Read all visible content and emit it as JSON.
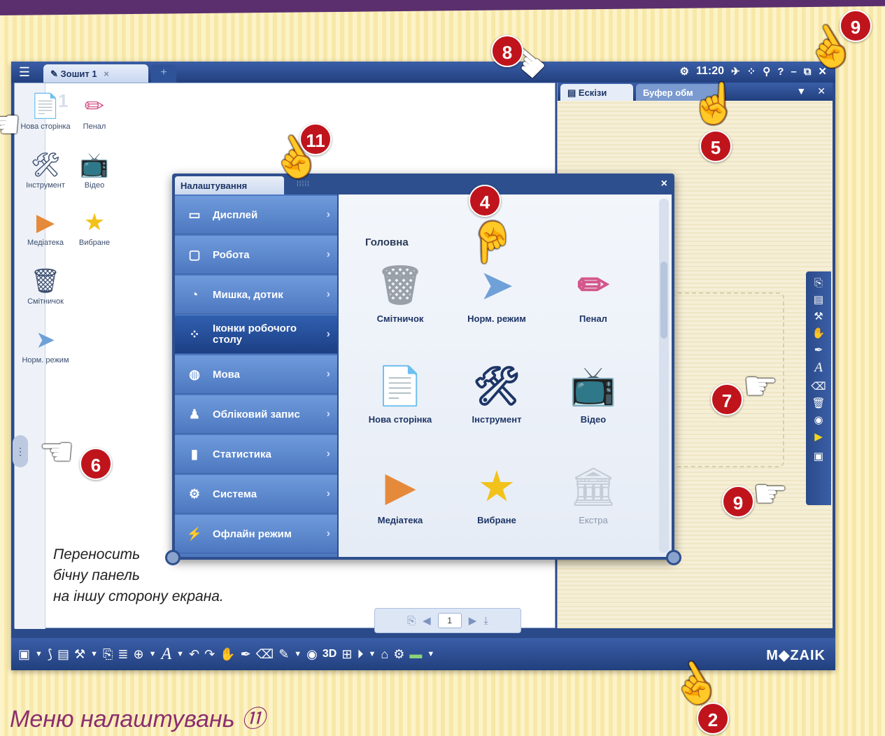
{
  "app": {
    "tab_title": "Зошит 1",
    "tab_close": "×",
    "tab_add": "+",
    "time": "11:20",
    "page_number": "1"
  },
  "desk_icons": [
    {
      "label": "Нова сторінка",
      "icon": "new-page-icon",
      "glyph": "📄"
    },
    {
      "label": "Пенал",
      "icon": "pencil-case-icon",
      "glyph": "✏"
    },
    {
      "label": "Інструмент",
      "icon": "tools-icon",
      "glyph": "🛠"
    },
    {
      "label": "Відео",
      "icon": "tv-icon",
      "glyph": "📺"
    },
    {
      "label": "Медіатека",
      "icon": "media-library-icon",
      "glyph": "▶"
    },
    {
      "label": "Вибране",
      "icon": "star-icon",
      "glyph": "★"
    },
    {
      "label": "Смітничок",
      "icon": "trash-icon",
      "glyph": "🗑"
    },
    {
      "label": "Норм. режим",
      "icon": "cursor-icon",
      "glyph": "➤"
    }
  ],
  "right_panel": {
    "tab_sketches": "Ескізи",
    "tab_clipboard": "Буфер обм"
  },
  "settings": {
    "title": "Налаштування",
    "close": "×",
    "menu": [
      {
        "label": "Дисплей",
        "icon": "monitor-icon",
        "glyph": "▭"
      },
      {
        "label": "Робота",
        "icon": "window-icon",
        "glyph": "▢"
      },
      {
        "label": "Мишка, дотик",
        "icon": "mouse-icon",
        "glyph": "◔"
      },
      {
        "label": "Іконки робочого столу",
        "icon": "desktop-icons-icon",
        "glyph": "⁘"
      },
      {
        "label": "Мова",
        "icon": "globe-icon",
        "glyph": "◍"
      },
      {
        "label": "Обліковий запис",
        "icon": "account-icon",
        "glyph": "♟"
      },
      {
        "label": "Статистика",
        "icon": "stats-icon",
        "glyph": "▮"
      },
      {
        "label": "Система",
        "icon": "gear-icon",
        "glyph": "⚙"
      },
      {
        "label": "Офлайн режим",
        "icon": "offline-icon",
        "glyph": "⚡"
      }
    ],
    "selected_index": 3,
    "heading": "Головна",
    "items": [
      {
        "label": "Смітничок",
        "icon": "trash-icon",
        "glyph": "🗑"
      },
      {
        "label": "Норм. режим",
        "icon": "cursor-icon",
        "glyph": "➤"
      },
      {
        "label": "Пенал",
        "icon": "pencil-case-icon",
        "glyph": "✏"
      },
      {
        "label": "Нова сторінка",
        "icon": "new-page-icon",
        "glyph": "📄"
      },
      {
        "label": "Інструмент",
        "icon": "tools-icon",
        "glyph": "🛠"
      },
      {
        "label": "Відео",
        "icon": "tv-icon",
        "glyph": "📺"
      },
      {
        "label": "Медіатека",
        "icon": "media-library-icon",
        "glyph": "▶"
      },
      {
        "label": "Вибране",
        "icon": "star-icon",
        "glyph": "★"
      },
      {
        "label": "Екстра",
        "icon": "extra-icon",
        "glyph": "🏛"
      }
    ]
  },
  "bottom": {
    "logo": "M◆ZAIK"
  },
  "annotation": {
    "note_lines": [
      "Переносить",
      "бічну панель",
      "на іншу сторону екрана."
    ],
    "caption": "Меню налаштувань ⑪",
    "badges": [
      "2",
      "4",
      "5",
      "6",
      "7",
      "8",
      "9",
      "9",
      "11"
    ]
  }
}
